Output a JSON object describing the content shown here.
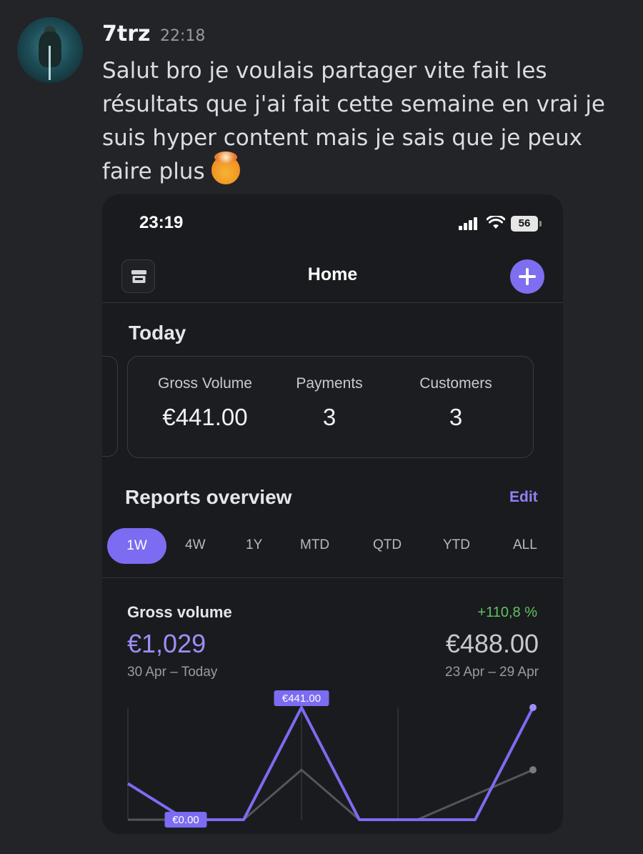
{
  "message": {
    "username": "7trz",
    "timestamp": "22:18",
    "text": "Salut bro je voulais partager vite fait les résultats que j'ai fait cette semaine en vrai je suis hyper content mais je sais que je peux faire plus",
    "emoji": "exploding-head-emoji"
  },
  "phone": {
    "status_bar": {
      "time": "23:19",
      "battery": "56"
    },
    "nav": {
      "title": "Home"
    },
    "today": {
      "heading": "Today",
      "stats": [
        {
          "label": "Gross Volume",
          "value": "€441.00"
        },
        {
          "label": "Payments",
          "value": "3"
        },
        {
          "label": "Customers",
          "value": "3"
        }
      ]
    },
    "reports": {
      "heading": "Reports overview",
      "edit_label": "Edit",
      "tabs": [
        "1W",
        "4W",
        "1Y",
        "MTD",
        "QTD",
        "YTD",
        "ALL"
      ],
      "active_tab": "1W"
    },
    "gross_volume": {
      "title": "Gross volume",
      "change": "+110,8 %",
      "current_value": "€1,029",
      "current_range": "30 Apr – Today",
      "previous_value": "€488.00",
      "previous_range": "23 Apr – 29 Apr"
    }
  },
  "chart_data": {
    "type": "line",
    "ylim": [
      0,
      441
    ],
    "grid": "vertical",
    "series": [
      {
        "color": "#7b6cf2",
        "values": [
          142,
          0,
          0,
          441,
          0,
          0,
          0,
          441
        ]
      },
      {
        "color": "#55565c",
        "values": [
          0,
          0,
          0,
          196,
          0,
          0,
          98,
          196
        ]
      }
    ],
    "annotations": [
      {
        "series": 0,
        "point": 3,
        "text": "€441.00"
      },
      {
        "series": 0,
        "point": 1,
        "text": "€0.00"
      }
    ]
  }
}
